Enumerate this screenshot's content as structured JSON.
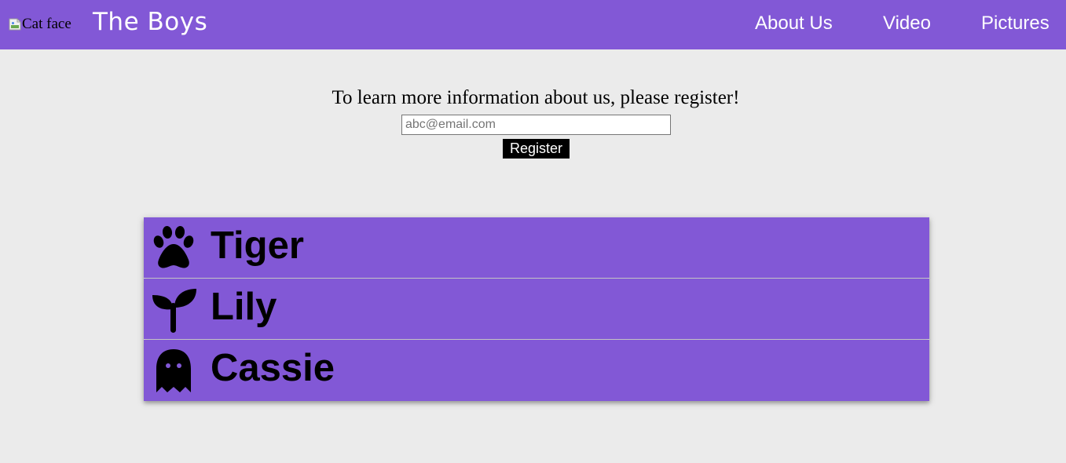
{
  "header": {
    "logo_alt": "Cat face",
    "title": "The Boys",
    "nav": {
      "about": "About Us",
      "video": "Video",
      "pictures": "Pictures"
    },
    "background_color": "#8258d6"
  },
  "register": {
    "prompt": "To learn more information about us, please register!",
    "email_placeholder": "abc@email.com",
    "button_label": "Register"
  },
  "cats": [
    {
      "name": "Tiger",
      "icon": "paw-icon"
    },
    {
      "name": "Lily",
      "icon": "sprout-icon"
    },
    {
      "name": "Cassie",
      "icon": "ghost-icon"
    }
  ],
  "colors": {
    "accent": "#8258d6",
    "page_background": "#ebebeb",
    "button_background": "#000000",
    "button_text": "#ffffff"
  }
}
